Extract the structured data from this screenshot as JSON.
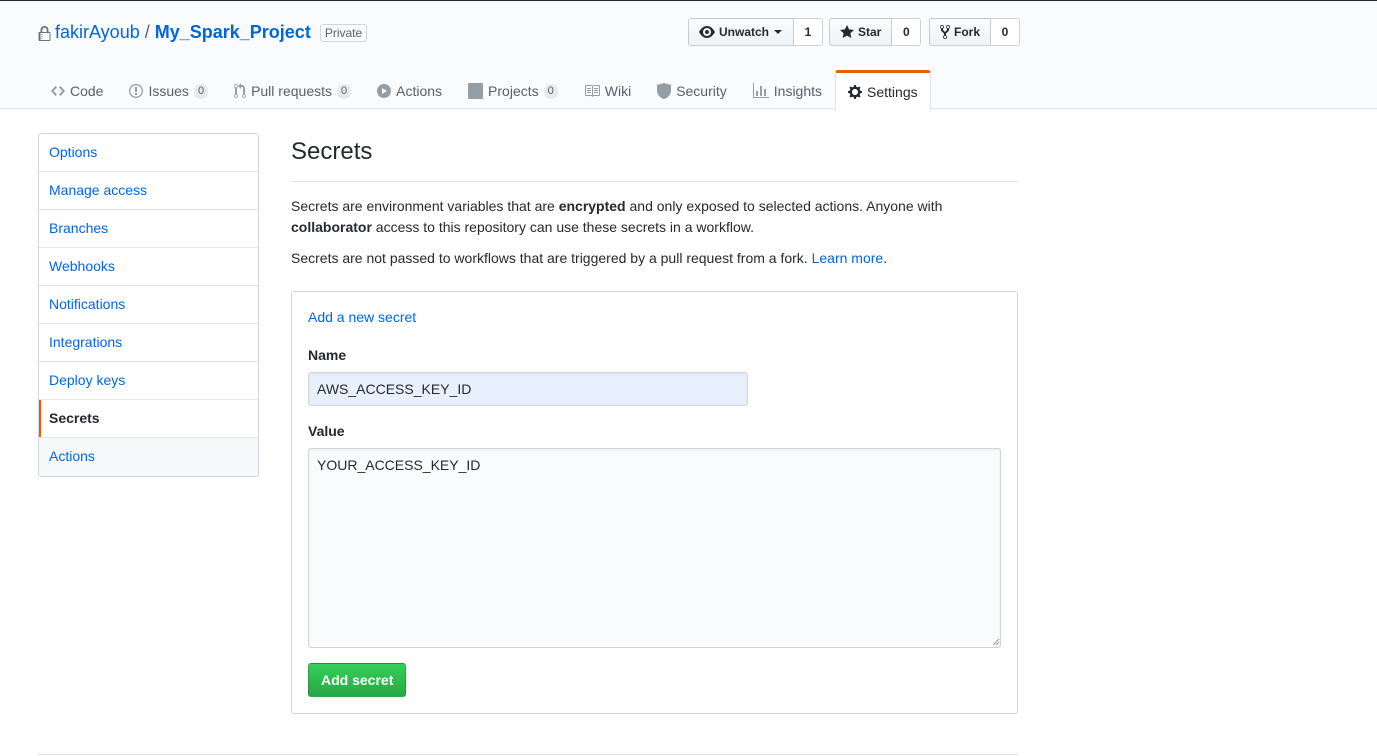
{
  "repo": {
    "owner": "fakirAyoub",
    "separator": "/",
    "name": "My_Spark_Project",
    "visibility": "Private"
  },
  "actions": {
    "watch": {
      "label": "Unwatch",
      "count": "1"
    },
    "star": {
      "label": "Star",
      "count": "0"
    },
    "fork": {
      "label": "Fork",
      "count": "0"
    }
  },
  "nav": {
    "code": {
      "label": "Code"
    },
    "issues": {
      "label": "Issues",
      "count": "0"
    },
    "pulls": {
      "label": "Pull requests",
      "count": "0"
    },
    "actions": {
      "label": "Actions"
    },
    "projects": {
      "label": "Projects",
      "count": "0"
    },
    "wiki": {
      "label": "Wiki"
    },
    "security": {
      "label": "Security"
    },
    "insights": {
      "label": "Insights"
    },
    "settings": {
      "label": "Settings"
    }
  },
  "sidebar": {
    "items": [
      {
        "label": "Options"
      },
      {
        "label": "Manage access"
      },
      {
        "label": "Branches"
      },
      {
        "label": "Webhooks"
      },
      {
        "label": "Notifications"
      },
      {
        "label": "Integrations"
      },
      {
        "label": "Deploy keys"
      },
      {
        "label": "Secrets"
      },
      {
        "label": "Actions"
      }
    ],
    "selected": "Secrets"
  },
  "main": {
    "title": "Secrets",
    "desc_part1": "Secrets are environment variables that are ",
    "desc_bold1": "encrypted",
    "desc_part2": " and only exposed to selected actions. Anyone with",
    "desc_bold2": "collaborator",
    "desc_part3": " access to this repository can use these secrets in a workflow.",
    "fork_note": "Secrets are not passed to workflows that are triggered by a pull request from a fork. ",
    "learn_more": "Learn more",
    "period": "."
  },
  "form": {
    "add_link": "Add a new secret",
    "name_label": "Name",
    "name_value": "AWS_ACCESS_KEY_ID",
    "value_label": "Value",
    "value_value": "YOUR_ACCESS_KEY_ID",
    "submit_label": "Add secret"
  },
  "colors": {
    "accent": "#e36209",
    "link": "#0366d6",
    "primary_button": "#28a745"
  }
}
